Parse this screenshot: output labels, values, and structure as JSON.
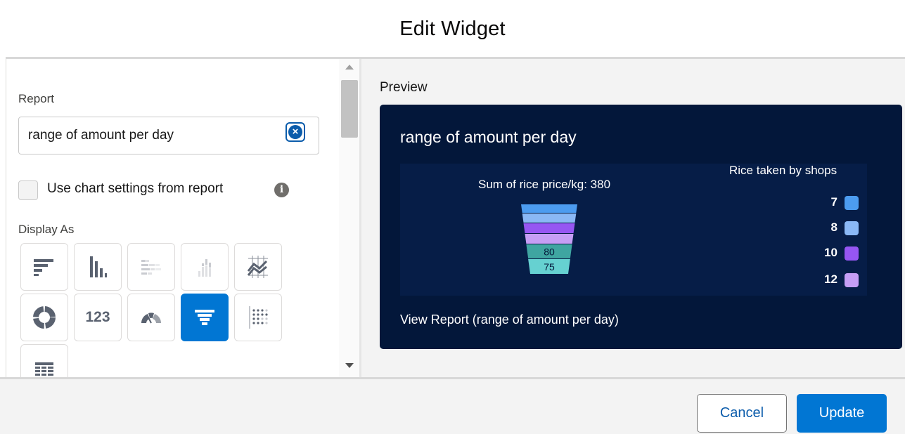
{
  "modal": {
    "title": "Edit Widget"
  },
  "report": {
    "label": "Report",
    "value": "range of amount per day",
    "clear_icon": "clear-circle-icon"
  },
  "chart_settings": {
    "label": "Use chart settings from report",
    "checked": false,
    "info_icon": "info-icon"
  },
  "display_as": {
    "label": "Display As",
    "options": [
      {
        "name": "horizontal-bar",
        "selected": false
      },
      {
        "name": "vertical-bar",
        "selected": false
      },
      {
        "name": "stacked-horizontal-bar",
        "selected": false
      },
      {
        "name": "stacked-vertical-bar",
        "selected": false
      },
      {
        "name": "line",
        "selected": false
      },
      {
        "name": "donut",
        "selected": false
      },
      {
        "name": "metric",
        "label": "123",
        "selected": false
      },
      {
        "name": "gauge",
        "selected": false
      },
      {
        "name": "funnel",
        "selected": true
      },
      {
        "name": "scatter",
        "selected": false
      },
      {
        "name": "table",
        "selected": false
      }
    ]
  },
  "preview": {
    "label": "Preview",
    "card_title": "range of amount per day",
    "view_link": "View Report (range of amount per day)"
  },
  "chart_data": {
    "type": "funnel",
    "title": "Sum of rice price/kg: 380",
    "legend_title": "Rice taken by shops",
    "legend_position": "right",
    "segments": [
      {
        "name": "7",
        "value": null,
        "color": "#4c9cf0"
      },
      {
        "name": "8",
        "value": null,
        "color": "#8ab8f5"
      },
      {
        "name": "10",
        "value": null,
        "color": "#9656f2"
      },
      {
        "name": "12",
        "value": null,
        "color": "#c69ef5"
      },
      {
        "name": "",
        "value": 80,
        "color": "#3fa5a1"
      },
      {
        "name": "",
        "value": 75,
        "color": "#66d1d1"
      }
    ],
    "legend": [
      {
        "label": "7",
        "color": "#4c9cf0"
      },
      {
        "label": "8",
        "color": "#8ab8f5"
      },
      {
        "label": "10",
        "color": "#9656f2"
      },
      {
        "label": "12",
        "color": "#c69ef5"
      }
    ]
  },
  "footer": {
    "cancel_label": "Cancel",
    "update_label": "Update"
  }
}
